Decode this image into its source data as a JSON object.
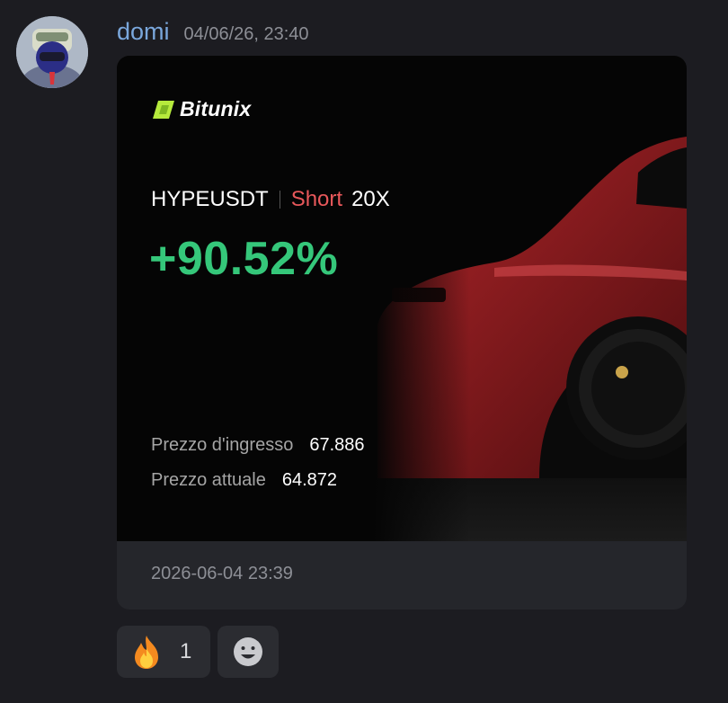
{
  "message": {
    "author": "domi",
    "timestamp": "04/06/26, 23:40",
    "avatar_icon": "avatar-icon"
  },
  "card": {
    "brand": "Bitunix",
    "pair": "HYPEUSDT",
    "side": "Short",
    "leverage": "20X",
    "pnl_percent": "+90.52%",
    "entry_label": "Prezzo d'ingresso",
    "entry_value": "67.886",
    "current_label": "Prezzo attuale",
    "current_value": "64.872",
    "footer_date": "2026-06-04 23:39",
    "colors": {
      "pnl": "#35c77a",
      "side": "#e8585b",
      "brand_mark": "#b6ea3c",
      "car": "#8e1d1f"
    }
  },
  "reactions": [
    {
      "icon": "fire-emoji-icon",
      "count": "1"
    }
  ],
  "add_reaction_icon": "smiley-add-reaction-icon"
}
